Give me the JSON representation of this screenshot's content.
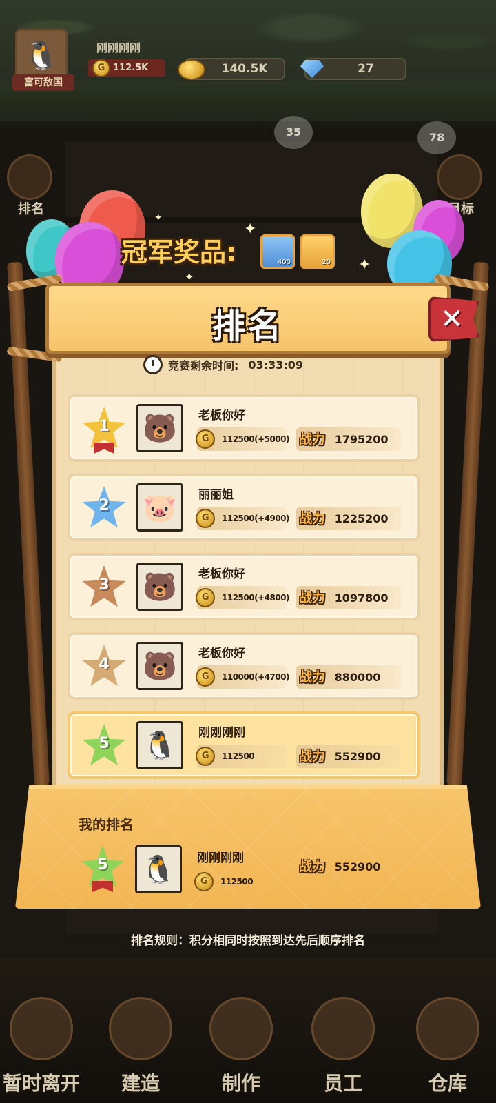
{
  "hud": {
    "player_name": "刚刚刚刚",
    "player_coins": "112.5K",
    "banner": "富可敌国",
    "gold": "140.5K",
    "gems": "27",
    "bubble_left": "35",
    "bubble_right": "78",
    "side_left_label": "排名",
    "side_right_label": "目标"
  },
  "modal": {
    "title": "排名",
    "prize_label": "冠军奖品:",
    "prizes": [
      {
        "icon": "diamond-icon",
        "count": "400"
      },
      {
        "icon": "gold-nugget-icon",
        "count": "20"
      }
    ],
    "timer_label": "竞赛剩余时间:",
    "timer_value": "03:33:09",
    "power_label": "战力",
    "close_label": "✕"
  },
  "ranking": [
    {
      "rank": "1",
      "name": "老板你好",
      "score": "112500(+5000)",
      "power": "1795200",
      "avatar": "bear-mustache-avatar",
      "star_color": "#f3c23a",
      "highlight": false
    },
    {
      "rank": "2",
      "name": "丽丽姐",
      "score": "112500(+4900)",
      "power": "1225200",
      "avatar": "nurse-pig-avatar",
      "star_color": "#6fb4ec",
      "highlight": false
    },
    {
      "rank": "3",
      "name": "老板你好",
      "score": "112500(+4800)",
      "power": "1097800",
      "avatar": "bear-mustache-avatar",
      "star_color": "#c88a5a",
      "highlight": false
    },
    {
      "rank": "4",
      "name": "老板你好",
      "score": "110000(+4700)",
      "power": "880000",
      "avatar": "bear-mustache-avatar",
      "star_color": "#d6aa74",
      "highlight": false
    },
    {
      "rank": "5",
      "name": "刚刚刚刚",
      "score": "112500",
      "power": "552900",
      "avatar": "rainbow-hair-goose-avatar",
      "star_color": "#8fd45a",
      "highlight": true
    }
  ],
  "my_rank": {
    "title": "我的排名",
    "rank": "5",
    "name": "刚刚刚刚",
    "score": "112500",
    "power": "552900",
    "star_color": "#8fd45a"
  },
  "rule": "排名规则：积分相同时按照到达先后顺序排名",
  "nav": [
    {
      "label": "暂时离开",
      "icon": "exit-door-icon"
    },
    {
      "label": "建造",
      "icon": "hammer-icon"
    },
    {
      "label": "制作",
      "icon": "cooking-pot-icon"
    },
    {
      "label": "员工",
      "icon": "staff-face-icon"
    },
    {
      "label": "仓库",
      "icon": "chest-icon"
    }
  ]
}
